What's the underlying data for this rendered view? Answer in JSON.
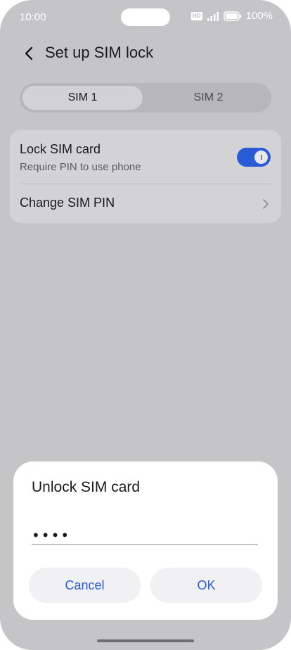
{
  "status_bar": {
    "time": "10:00",
    "hd_label": "HD",
    "battery": "100%"
  },
  "header": {
    "title": "Set up SIM lock",
    "back_icon": "back-icon"
  },
  "sim_tabs": [
    {
      "label": "SIM 1",
      "active": true
    },
    {
      "label": "SIM 2",
      "active": false
    }
  ],
  "settings": {
    "lock_sim": {
      "title": "Lock SIM card",
      "subtitle": "Require PIN to use phone",
      "enabled": true
    },
    "change_pin": {
      "title": "Change SIM PIN"
    }
  },
  "dialog": {
    "title": "Unlock SIM card",
    "pin_value": "••••",
    "cancel_label": "Cancel",
    "ok_label": "OK"
  },
  "colors": {
    "accent": "#2a5bd7",
    "background": "#c5c5c8",
    "card": "#d3d3d5",
    "dialog": "#ffffff"
  }
}
